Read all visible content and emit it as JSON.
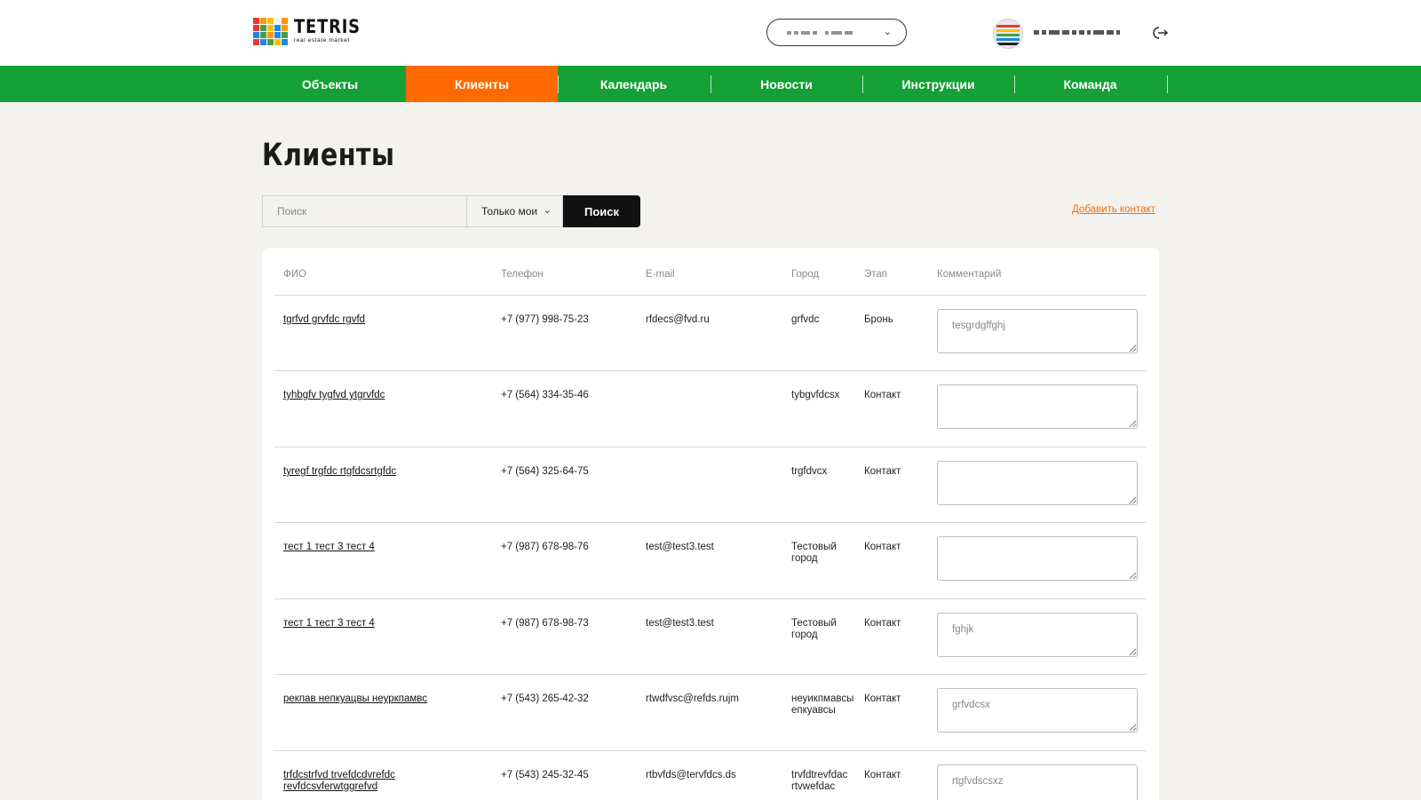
{
  "brand": {
    "title": "TETRIS",
    "subtitle": "real estate market"
  },
  "colors": {
    "nav_green": "#14a037",
    "nav_active_orange": "#ff6a00",
    "link_orange": "#ff6a00",
    "search_button": "#111111"
  },
  "header": {
    "city_select_icon": "chevron-down-icon",
    "logout_icon": "logout-icon"
  },
  "nav": {
    "items": [
      {
        "label": "Объекты",
        "active": false
      },
      {
        "label": "Клиенты",
        "active": true
      },
      {
        "label": "Календарь",
        "active": false
      },
      {
        "label": "Новости",
        "active": false
      },
      {
        "label": "Инструкции",
        "active": false
      },
      {
        "label": "Команда",
        "active": false
      }
    ]
  },
  "page": {
    "title": "Клиенты"
  },
  "search": {
    "placeholder": "Поиск",
    "value": "",
    "filter_selected": "Только мои",
    "button_label": "Поиск",
    "add_contact_label": "Добавить контакт"
  },
  "table": {
    "headers": [
      "ФИО",
      "Телефон",
      "E-mail",
      "Город",
      "Этап",
      "Комментарий"
    ],
    "rows": [
      {
        "name": "tgrfvd grvfdc rgvfd",
        "phone": "+7 (977) 998-75-23",
        "email": "rfdecs@fvd.ru",
        "city": "grfvdc",
        "stage": "Бронь",
        "comment": "tesgrdgffghj"
      },
      {
        "name": "tyhbgfv tygfvd ytgrvfdc",
        "phone": "+7 (564) 334-35-46",
        "email": "",
        "city": "tybgvfdcsx",
        "stage": "Контакт",
        "comment": ""
      },
      {
        "name": "tyregf trgfdc rtgfdcsrtgfdc",
        "phone": "+7 (564) 325-64-75",
        "email": "",
        "city": "trgfdvcx",
        "stage": "Контакт",
        "comment": ""
      },
      {
        "name": "тест 1 тест 3 тест 4",
        "phone": "+7 (987) 678-98-76",
        "email": "test@test3.test",
        "city": "Тестовый город",
        "stage": "Контакт",
        "comment": ""
      },
      {
        "name": "тест 1 тест 3 тест 4",
        "phone": "+7 (987) 678-98-73",
        "email": "test@test3.test",
        "city": "Тестовый город",
        "stage": "Контакт",
        "comment": "fghjk"
      },
      {
        "name": "рекпав непкуацвы неуркпамвс",
        "phone": "+7 (543) 265-42-32",
        "email": "rtwdfvsc@refds.rujm",
        "city": "неуикпмавсы епкуавсы",
        "stage": "Контакт",
        "comment": "grfvdcsx"
      },
      {
        "name": "trfdcstrfvd trvefdcdvrefdc revfdcsvferwtggrefvd",
        "phone": "+7 (543) 245-32-45",
        "email": "rtbvfds@tervfdcs.ds",
        "city": "trvfdtrevfdac rtvwefdac",
        "stage": "Контакт",
        "comment": "rtgfvdscsxz"
      }
    ]
  }
}
